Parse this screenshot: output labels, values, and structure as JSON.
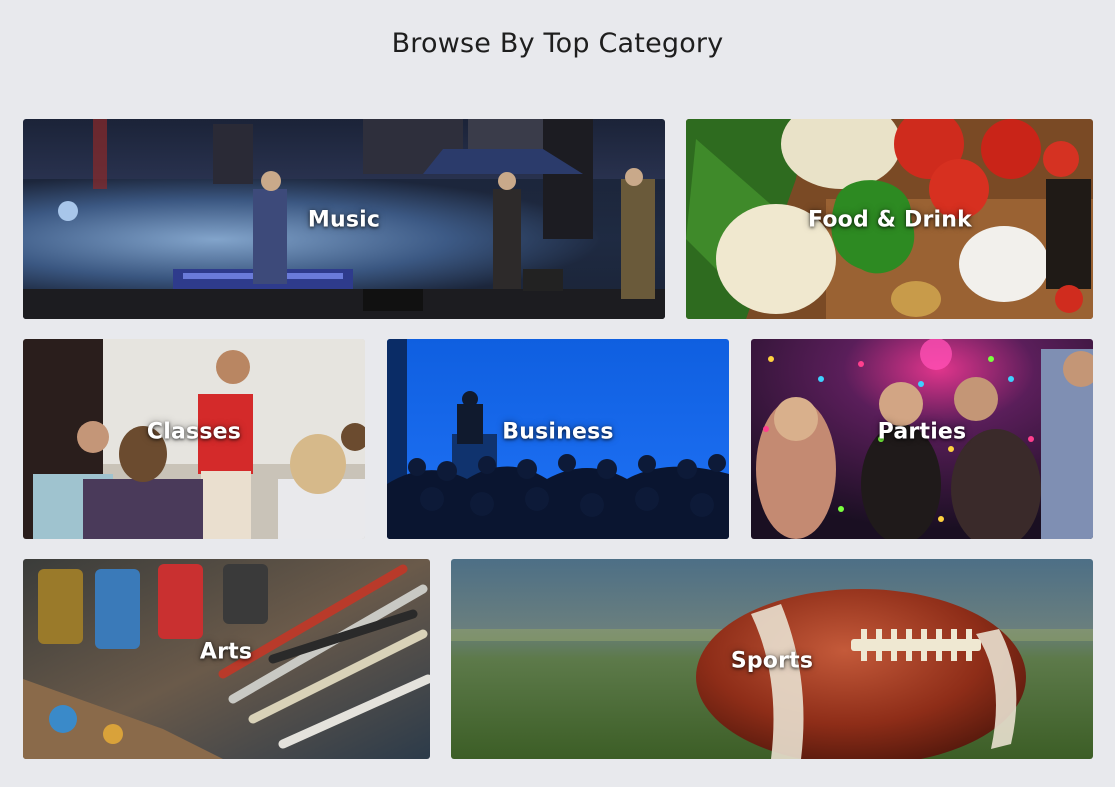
{
  "header": {
    "title": "Browse By Top Category"
  },
  "categories": [
    {
      "label": "Music"
    },
    {
      "label": "Food & Drink"
    },
    {
      "label": "Classes"
    },
    {
      "label": "Business"
    },
    {
      "label": "Parties"
    },
    {
      "label": "Arts"
    },
    {
      "label": "Sports"
    }
  ]
}
